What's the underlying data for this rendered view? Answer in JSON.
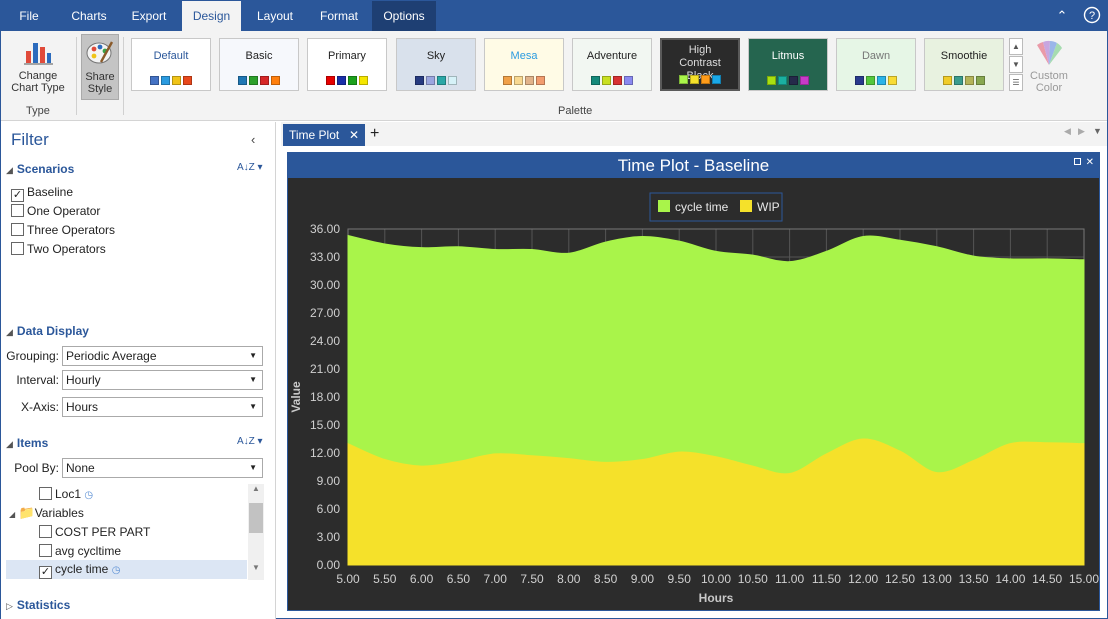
{
  "menubar": {
    "tabs": [
      "File",
      "Charts",
      "Export",
      "Design",
      "Layout",
      "Format",
      "Options"
    ],
    "active": "Design"
  },
  "ribbon": {
    "change_chart_type": "Change\nChart Type",
    "type_group": "Type",
    "share_style": "Share\nStyle",
    "palette_group": "Palette",
    "custom_color": "Custom\nColor",
    "palettes": [
      {
        "name": "Default",
        "bg": "#ffffff",
        "fg": "#2b579a",
        "colors": [
          "#4472c4",
          "#2b9be0",
          "#f0c418",
          "#e8481c"
        ]
      },
      {
        "name": "Basic",
        "bg": "#f6f8fc",
        "fg": "#222",
        "colors": [
          "#1f77b4",
          "#2ca02c",
          "#d62728",
          "#ff7f0e"
        ]
      },
      {
        "name": "Primary",
        "bg": "#ffffff",
        "fg": "#222",
        "colors": [
          "#e60000",
          "#1a2fa8",
          "#1ca11c",
          "#f5e600"
        ]
      },
      {
        "name": "Sky",
        "bg": "#d9e1ec",
        "fg": "#222",
        "colors": [
          "#263a80",
          "#9ba6e0",
          "#2aa7a7",
          "#d6f2f8"
        ]
      },
      {
        "name": "Mesa",
        "bg": "#fffbe6",
        "fg": "#2b9be0",
        "colors": [
          "#f0a048",
          "#f8d890",
          "#e1b38a",
          "#f29c6e"
        ]
      },
      {
        "name": "Adventure",
        "bg": "#f2f7f2",
        "fg": "#222",
        "colors": [
          "#148a7a",
          "#c8e020",
          "#d73232",
          "#8a8af0"
        ]
      },
      {
        "name": "High Contrast Black",
        "bg": "#2b2b2b",
        "fg": "#dddddd",
        "colors": [
          "#a9f44a",
          "#f5e12a",
          "#ff9c1a",
          "#1aa8e8"
        ]
      },
      {
        "name": "Litmus",
        "bg": "#25654f",
        "fg": "#ffffff",
        "colors": [
          "#a8e010",
          "#1ab0a0",
          "#252a4a",
          "#c83ac8"
        ]
      },
      {
        "name": "Dawn",
        "bg": "#e6f6e6",
        "fg": "#777",
        "colors": [
          "#283a8c",
          "#54c83c",
          "#2ab4e8",
          "#f8dc34"
        ]
      },
      {
        "name": "Smoothie",
        "bg": "#e8f2e0",
        "fg": "#222",
        "colors": [
          "#f0cc28",
          "#3a9c8c",
          "#b4b458",
          "#88a850"
        ]
      }
    ]
  },
  "filter": {
    "title": "Filter",
    "scenarios_title": "Scenarios",
    "scenarios": [
      {
        "label": "Baseline",
        "checked": true
      },
      {
        "label": "One Operator",
        "checked": false
      },
      {
        "label": "Three Operators",
        "checked": false
      },
      {
        "label": "Two Operators",
        "checked": false
      }
    ],
    "data_display_title": "Data Display",
    "grouping_label": "Grouping:",
    "grouping_value": "Periodic Average",
    "interval_label": "Interval:",
    "interval_value": "Hourly",
    "xaxis_label": "X-Axis:",
    "xaxis_value": "Hours",
    "items_title": "Items",
    "pool_label": "Pool By:",
    "pool_value": "None",
    "tree": [
      {
        "label": "Loc1",
        "checked": false,
        "clock": true
      },
      {
        "label": "Variables",
        "folder": true
      },
      {
        "label": "COST PER PART",
        "checked": false
      },
      {
        "label": "avg cycltime",
        "checked": false
      },
      {
        "label": "cycle time",
        "checked": true,
        "clock": true
      }
    ],
    "statistics_title": "Statistics"
  },
  "doc_tab": "Time Plot",
  "chart_data": {
    "type": "area",
    "title": "Time Plot - Baseline",
    "xlabel": "Hours",
    "ylabel": "Value",
    "xlim": [
      5,
      15
    ],
    "ylim": [
      0,
      36
    ],
    "x_ticks": [
      "5.00",
      "5.50",
      "6.00",
      "6.50",
      "7.00",
      "7.50",
      "8.00",
      "8.50",
      "9.00",
      "9.50",
      "10.00",
      "10.50",
      "11.00",
      "11.50",
      "12.00",
      "12.50",
      "13.00",
      "13.50",
      "14.00",
      "14.50",
      "15.00"
    ],
    "y_ticks": [
      "0.00",
      "3.00",
      "6.00",
      "9.00",
      "12.00",
      "15.00",
      "18.00",
      "21.00",
      "24.00",
      "27.00",
      "30.00",
      "33.00",
      "36.00"
    ],
    "legend_position": "top-center",
    "grid": true,
    "x": [
      5,
      5.5,
      6,
      6.5,
      7,
      7.5,
      8,
      8.5,
      9,
      9.5,
      10,
      10.5,
      11,
      11.5,
      12,
      12.5,
      13,
      13.5,
      14,
      14.5,
      15
    ],
    "series": [
      {
        "name": "cycle time",
        "color": "#a9f44a",
        "values": [
          35.3,
          34.4,
          34.0,
          34.1,
          33.8,
          33.8,
          33.4,
          34.6,
          35.2,
          34.7,
          33.6,
          33.2,
          32.5,
          33.6,
          35.2,
          34.8,
          34.1,
          33.1,
          32.8,
          32.8,
          32.7
        ]
      },
      {
        "name": "WIP",
        "color": "#f5e12a",
        "values": [
          13.0,
          11.3,
          10.6,
          11.1,
          11.9,
          11.7,
          11.4,
          11.0,
          11.3,
          12.1,
          11.6,
          10.6,
          9.8,
          11.9,
          13.5,
          12.2,
          9.9,
          11.2,
          13.0,
          13.1,
          13.0
        ]
      }
    ]
  }
}
